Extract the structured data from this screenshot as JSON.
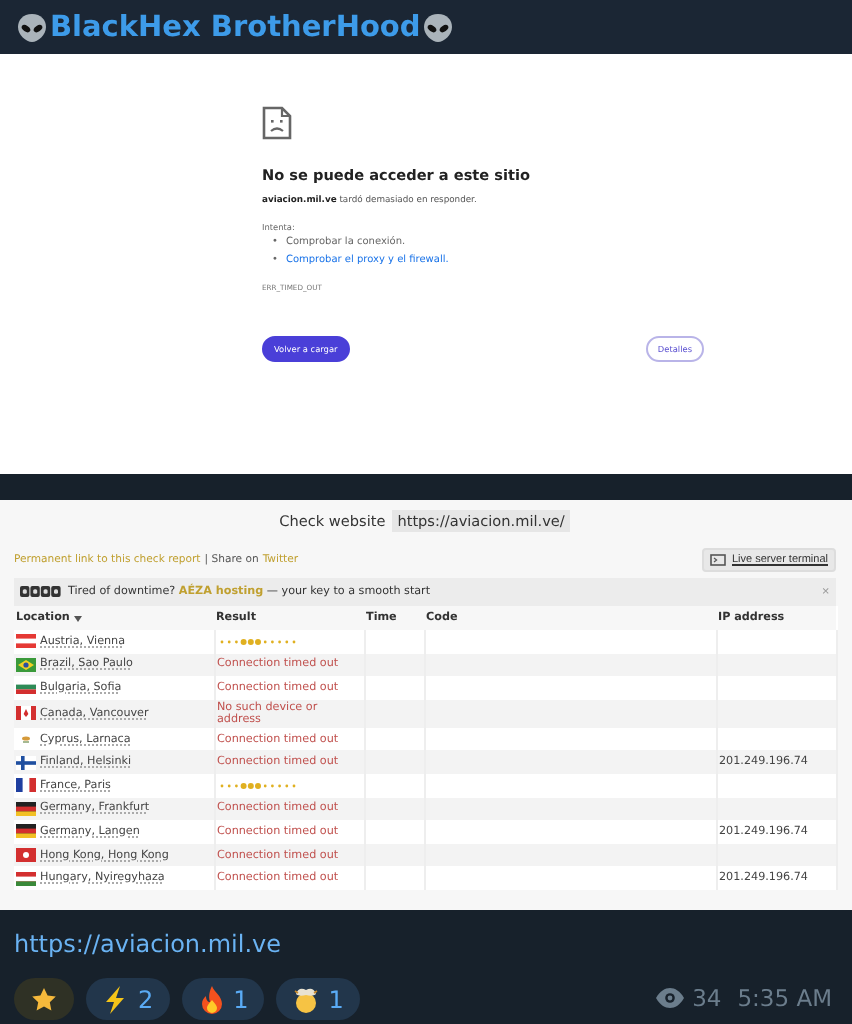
{
  "channel": {
    "title": "BlackHex BrotherHood"
  },
  "error_page": {
    "heading": "No se puede acceder a este sitio",
    "message": "**aviacion.mil.ve** tardó demasiado en responder.",
    "tips_label": "Intenta:",
    "tips": [
      {
        "marker": "•",
        "text": "Comprobar la conexión.",
        "link": false
      },
      {
        "marker": "•",
        "text": "Comprobar el proxy y el firewall.",
        "link": true
      }
    ],
    "error_code": "ERR_TIMED_OUT",
    "buttons": [
      {
        "label": "Volver a cargar",
        "kind": "primary"
      },
      {
        "label": "Detalles",
        "kind": "secondary"
      }
    ]
  },
  "check_report": {
    "title": "Check website",
    "url": "https://aviacion.mil.ve/",
    "permalink": "Permanent link to this check report",
    "share_text": "| Share on",
    "share_link": "Twitter",
    "terminal_button": "Live server terminal",
    "banner": "Tired of downtime? **AÉZA hosting** — your key to a smooth start",
    "banner_close": "×",
    "table": {
      "columns": [
        {
          "label": "Location",
          "sort": true
        },
        {
          "label": "Result",
          "sort": false
        },
        {
          "label": "Time",
          "sort": false
        },
        {
          "label": "Code",
          "sort": false
        },
        {
          "label": "IP address",
          "sort": false
        }
      ],
      "rows": [
        {
          "location": "Austria, Vienna",
          "flag": {
            "kind": "at"
          },
          "result": {
            "kind": "pending"
          }
        },
        {
          "location": "Brazil, Sao Paulo",
          "flag": {
            "kind": "br"
          },
          "result": {
            "kind": "error",
            "text": "Connection timed out"
          }
        },
        {
          "location": "Bulgaria, Sofia",
          "flag": {
            "kind": "bg"
          },
          "result": {
            "kind": "error",
            "text": "Connection timed out"
          }
        },
        {
          "location": "Canada, Vancouver",
          "flag": {
            "kind": "ca"
          },
          "result": {
            "kind": "error",
            "text": "No such device or address"
          }
        },
        {
          "location": "Cyprus, Larnaca",
          "flag": {
            "kind": "cy"
          },
          "result": {
            "kind": "error",
            "text": "Connection timed out"
          }
        },
        {
          "location": "Finland, Helsinki",
          "flag": {
            "kind": "fi"
          },
          "result": {
            "kind": "error",
            "text": "Connection timed out"
          },
          "ip": "201.249.196.74"
        },
        {
          "location": "France, Paris",
          "flag": {
            "kind": "fr"
          },
          "result": {
            "kind": "pending"
          }
        },
        {
          "location": "Germany, Frankfurt",
          "flag": {
            "kind": "de"
          },
          "result": {
            "kind": "error",
            "text": "Connection timed out"
          }
        },
        {
          "location": "Germany, Langen",
          "flag": {
            "kind": "de"
          },
          "result": {
            "kind": "error",
            "text": "Connection timed out"
          },
          "ip": "201.249.196.74"
        },
        {
          "location": "Hong Kong, Hong Kong",
          "flag": {
            "kind": "hk"
          },
          "result": {
            "kind": "error",
            "text": "Connection timed out"
          }
        },
        {
          "location": "Hungary, Nyiregyhaza",
          "flag": {
            "kind": "hu"
          },
          "result": {
            "kind": "error",
            "text": "Connection timed out"
          },
          "ip": "201.249.196.74"
        }
      ]
    }
  },
  "message": {
    "link": "https://aviacion.mil.ve",
    "reactions": [
      {
        "kind": "star"
      },
      {
        "kind": "lightning",
        "count": "2"
      },
      {
        "kind": "fire",
        "count": "1"
      },
      {
        "kind": "exploding-head",
        "count": "1"
      }
    ],
    "views": "34",
    "time": "5:35 AM"
  }
}
